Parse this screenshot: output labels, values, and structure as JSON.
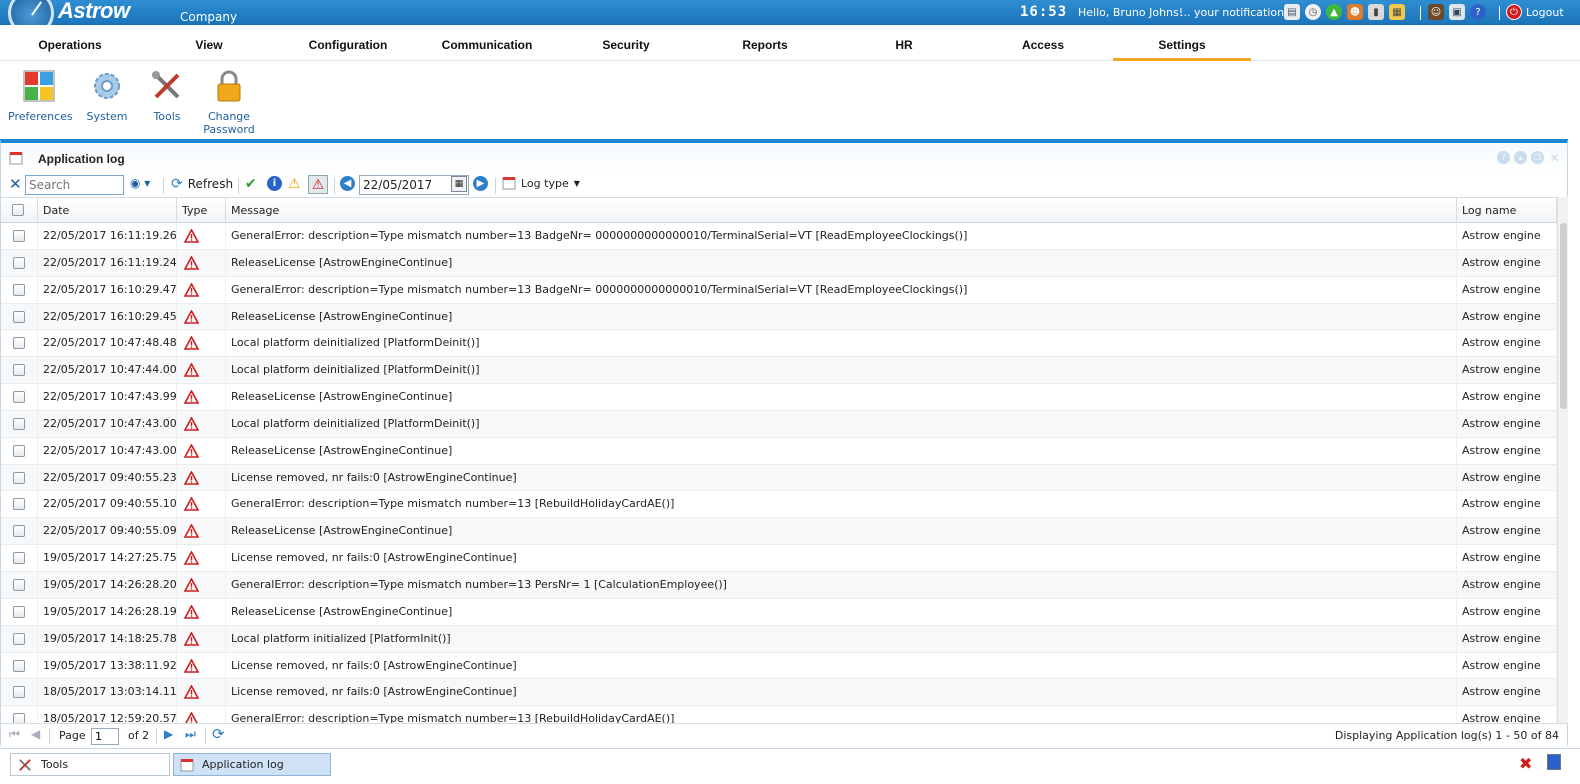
{
  "app": {
    "brand": "Astrow",
    "company": "Company",
    "clock": "16:53",
    "greeting": "Hello, Bruno Johns!",
    "notifications_label": "... your notifications:",
    "logout_label": "Logout"
  },
  "notification_icons": [
    "document-icon",
    "clock-icon",
    "upload-icon",
    "people-icon",
    "phone-icon",
    "calendar-icon",
    "user-icon",
    "tasks-icon",
    "help-icon"
  ],
  "menu": [
    {
      "label": "Operations"
    },
    {
      "label": "View"
    },
    {
      "label": "Configuration"
    },
    {
      "label": "Communication"
    },
    {
      "label": "Security"
    },
    {
      "label": "Reports"
    },
    {
      "label": "HR"
    },
    {
      "label": "Access"
    },
    {
      "label": "Settings",
      "active": true
    }
  ],
  "ribbon": {
    "preferences": "Preferences",
    "system": "System",
    "tools": "Tools",
    "change_password_1": "Change",
    "change_password_2": "Password"
  },
  "panel": {
    "title": "Application log"
  },
  "toolbar": {
    "search_placeholder": "Search",
    "refresh_label": "Refresh",
    "date_value": "22/05/2017",
    "log_type_label": "Log type"
  },
  "grid": {
    "headers": {
      "date": "Date",
      "type": "Type",
      "message": "Message",
      "log_name": "Log name"
    },
    "rows": [
      {
        "date": "22/05/2017 16:11:19.260",
        "message": "GeneralError: description=Type mismatch number=13 BadgeNr= 0000000000000010/TerminalSerial=VT [ReadEmployeeClockings()]",
        "log_name": "Astrow engine"
      },
      {
        "date": "22/05/2017 16:11:19.240",
        "message": "ReleaseLicense [AstrowEngineContinue]",
        "log_name": "Astrow engine"
      },
      {
        "date": "22/05/2017 16:10:29.473",
        "message": "GeneralError: description=Type mismatch number=13 BadgeNr= 0000000000000010/TerminalSerial=VT [ReadEmployeeClockings()]",
        "log_name": "Astrow engine"
      },
      {
        "date": "22/05/2017 16:10:29.453",
        "message": "ReleaseLicense [AstrowEngineContinue]",
        "log_name": "Astrow engine"
      },
      {
        "date": "22/05/2017 10:47:48.480",
        "message": "Local platform deinitialized [PlatformDeinit()]",
        "log_name": "Astrow engine"
      },
      {
        "date": "22/05/2017 10:47:44.000",
        "message": "Local platform deinitialized [PlatformDeinit()]",
        "log_name": "Astrow engine"
      },
      {
        "date": "22/05/2017 10:47:43.990",
        "message": "ReleaseLicense [AstrowEngineContinue]",
        "log_name": "Astrow engine"
      },
      {
        "date": "22/05/2017 10:47:43.000",
        "message": "Local platform deinitialized [PlatformDeinit()]",
        "log_name": "Astrow engine"
      },
      {
        "date": "22/05/2017 10:47:43.000",
        "message": "ReleaseLicense [AstrowEngineContinue]",
        "log_name": "Astrow engine"
      },
      {
        "date": "22/05/2017 09:40:55.230",
        "message": "License removed, nr fails:0 [AstrowEngineContinue]",
        "log_name": "Astrow engine"
      },
      {
        "date": "22/05/2017 09:40:55.100",
        "message": "GeneralError: description=Type mismatch number=13 [RebuildHolidayCardAE()]",
        "log_name": "Astrow engine"
      },
      {
        "date": "22/05/2017 09:40:55.093",
        "message": "ReleaseLicense [AstrowEngineContinue]",
        "log_name": "Astrow engine"
      },
      {
        "date": "19/05/2017 14:27:25.753",
        "message": "License removed, nr fails:0 [AstrowEngineContinue]",
        "log_name": "Astrow engine"
      },
      {
        "date": "19/05/2017 14:26:28.207",
        "message": "GeneralError: description=Type mismatch number=13 PersNr= 1 [CalculationEmployee()]",
        "log_name": "Astrow engine"
      },
      {
        "date": "19/05/2017 14:26:28.197",
        "message": "ReleaseLicense [AstrowEngineContinue]",
        "log_name": "Astrow engine"
      },
      {
        "date": "19/05/2017 14:18:25.787",
        "message": "Local platform initialized [PlatformInit()]",
        "log_name": "Astrow engine"
      },
      {
        "date": "19/05/2017 13:38:11.927",
        "message": "License removed, nr fails:0 [AstrowEngineContinue]",
        "log_name": "Astrow engine"
      },
      {
        "date": "18/05/2017 13:03:14.117",
        "message": "License removed, nr fails:0 [AstrowEngineContinue]",
        "log_name": "Astrow engine"
      },
      {
        "date": "18/05/2017 12:59:20.570",
        "message": "GeneralError: description=Type mismatch number=13 [RebuildHolidayCardAE()]",
        "log_name": "Astrow engine"
      }
    ]
  },
  "pager": {
    "page_label": "Page",
    "page_value": "1",
    "of_label": "of 2",
    "display_text": "Displaying Application log(s) 1 - 50 of 84"
  },
  "taskbar": {
    "tools_label": "Tools",
    "app_log_label": "Application log"
  }
}
